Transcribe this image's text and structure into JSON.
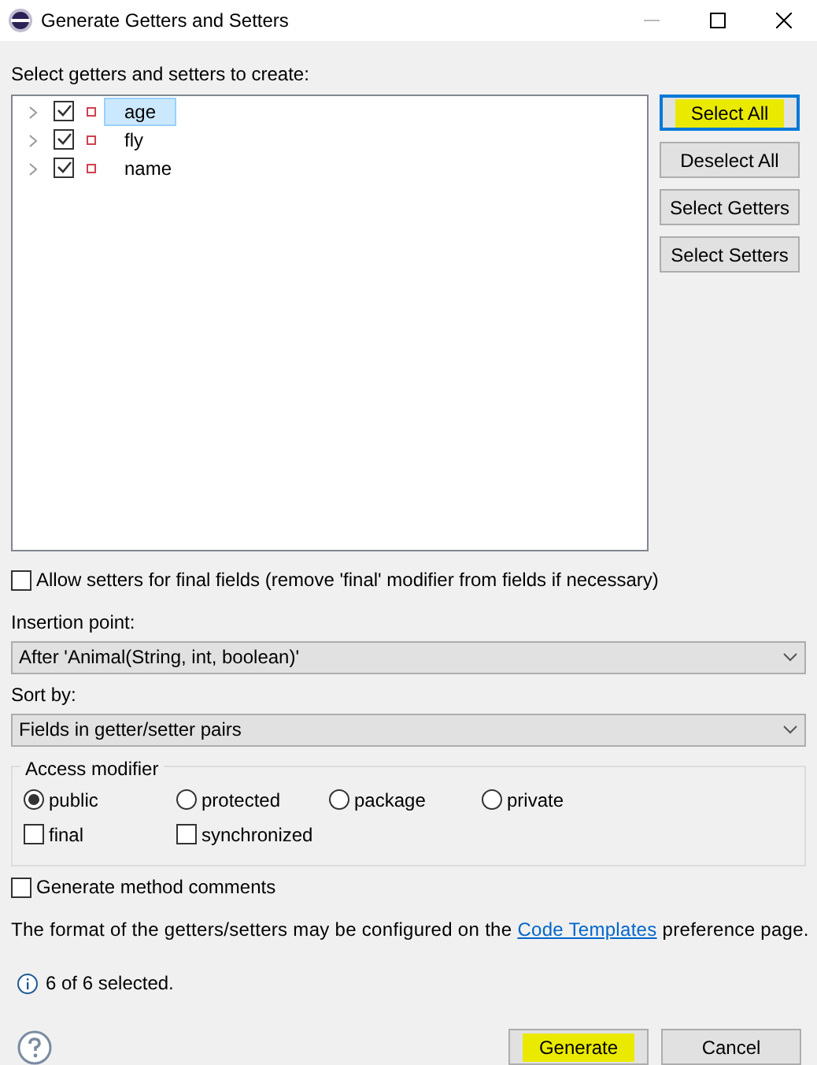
{
  "window": {
    "title": "Generate Getters and Setters"
  },
  "tree_label": "Select getters and setters to create:",
  "fields": [
    {
      "name": "age",
      "checked": true,
      "selected": true,
      "expanded": false
    },
    {
      "name": "fly",
      "checked": true,
      "selected": false,
      "expanded": false
    },
    {
      "name": "name",
      "checked": true,
      "selected": false,
      "expanded": false
    }
  ],
  "side_buttons": [
    {
      "label": "Select All",
      "focused": true,
      "highlighted": true
    },
    {
      "label": "Deselect All",
      "focused": false,
      "highlighted": false
    },
    {
      "label": "Select Getters",
      "focused": false,
      "highlighted": false
    },
    {
      "label": "Select Setters",
      "focused": false,
      "highlighted": false
    }
  ],
  "allow_final": {
    "label": "Allow setters for final fields (remove 'final' modifier from fields if necessary)",
    "checked": false
  },
  "insertion_point": {
    "label": "Insertion point:",
    "value": "After 'Animal(String, int, boolean)'"
  },
  "sort_by": {
    "label": "Sort by:",
    "value": "Fields in getter/setter pairs"
  },
  "access_modifier": {
    "title": "Access modifier",
    "options": [
      {
        "label": "public",
        "selected": true
      },
      {
        "label": "protected",
        "selected": false
      },
      {
        "label": "package",
        "selected": false
      },
      {
        "label": "private",
        "selected": false
      }
    ],
    "flags": [
      {
        "label": "final",
        "checked": false
      },
      {
        "label": "synchronized",
        "checked": false
      }
    ]
  },
  "comments": {
    "label": "Generate method comments",
    "checked": false
  },
  "note": {
    "before": "The format of the getters/setters may be configured on the",
    "link": "Code Templates",
    "after": "preference page."
  },
  "status": "6 of 6 selected.",
  "buttons": [
    {
      "label": "Generate",
      "highlighted": true
    },
    {
      "label": "Cancel",
      "highlighted": false
    }
  ]
}
